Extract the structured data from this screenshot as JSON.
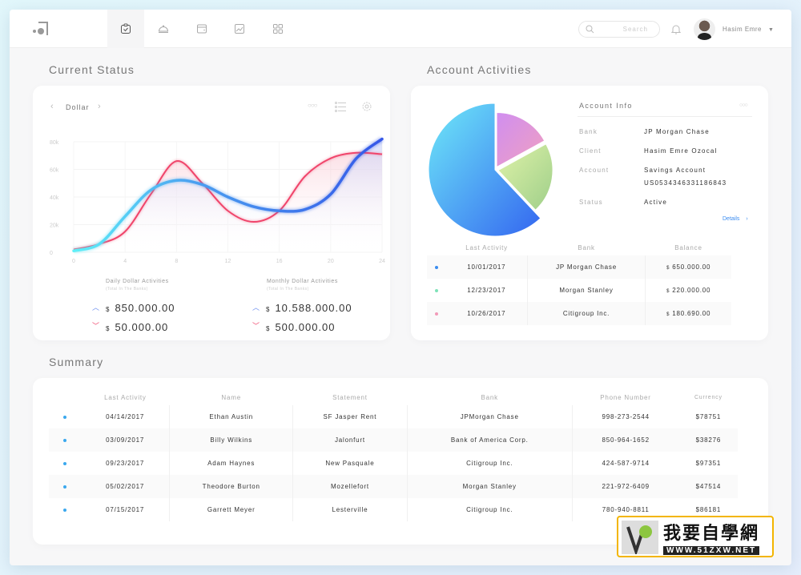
{
  "header": {
    "search_placeholder": "Search",
    "user_name": "Hasim Emre",
    "nav_icons": [
      "clipboard-check-icon",
      "cloche-icon",
      "wallet-icon",
      "chart-image-icon",
      "grid-icon"
    ],
    "active_nav": 0
  },
  "current_status": {
    "title": "Current Status",
    "currency": "Dollar",
    "daily": {
      "label": "Daily Dollar Activities",
      "sub": "(Total In The Banks)",
      "up": "850.000.00",
      "down": "50.000.00"
    },
    "monthly": {
      "label": "Monthly Dollar Activities",
      "sub": "(Total In The Banks)",
      "up": "10.588.000.00",
      "down": "500.000.00"
    },
    "currency_symbol": "$"
  },
  "chart_data": {
    "type": "line",
    "x": [
      0,
      2,
      4,
      6,
      8,
      10,
      12,
      14,
      16,
      18,
      20,
      22,
      24
    ],
    "xticks": [
      "0",
      "4",
      "8",
      "12",
      "16",
      "20",
      "24"
    ],
    "yticks": [
      "0",
      "20k",
      "40k",
      "60k",
      "80k"
    ],
    "xlim": [
      0,
      24
    ],
    "ylim": [
      0,
      80000
    ],
    "grid": true,
    "series": [
      {
        "color": "#3b82f6",
        "values": [
          1000,
          6000,
          26000,
          45000,
          52000,
          49000,
          40000,
          33000,
          30000,
          31000,
          42000,
          68000,
          82000
        ]
      },
      {
        "color": "#f0456b",
        "values": [
          2000,
          6000,
          15000,
          42000,
          66000,
          50000,
          30000,
          22000,
          30000,
          55000,
          68000,
          72000,
          71000
        ]
      }
    ]
  },
  "account": {
    "title": "Account Activities",
    "info_title": "Account Info",
    "fields": [
      {
        "k": "Bank",
        "v": "JP Morgan Chase"
      },
      {
        "k": "Client",
        "v": "Hasim Emre Ozocal"
      },
      {
        "k": "Account",
        "v": "Savings Account",
        "v2": "US0534346331186843"
      },
      {
        "k": "Status",
        "v": "Active"
      }
    ],
    "details": "Details",
    "pie": [
      {
        "share": 62,
        "colors": [
          "#6ee9f8",
          "#3466f0"
        ]
      },
      {
        "share": 17,
        "colors": [
          "#d08ef0",
          "#f0a0c0"
        ]
      },
      {
        "share": 21,
        "colors": [
          "#dff2a8",
          "#9fcf8a"
        ]
      }
    ],
    "headers": [
      "Last Activity",
      "Bank",
      "Balance"
    ],
    "rows": [
      {
        "dot": "#3b8cf0",
        "date": "10/01/2017",
        "bank": "JP Morgan Chase",
        "bal": "650.000.00"
      },
      {
        "dot": "#7ee2b8",
        "date": "12/23/2017",
        "bank": "Morgan Stanley",
        "bal": "220.000.00"
      },
      {
        "dot": "#f29ab8",
        "date": "10/26/2017",
        "bank": "Citigroup Inc.",
        "bal": "180.690.00"
      }
    ]
  },
  "summary": {
    "title": "Summary",
    "headers": [
      "Last Activity",
      "Name",
      "Statement",
      "Bank",
      "Phone Number",
      "Currency"
    ],
    "rows": [
      [
        "04/14/2017",
        "Ethan Austin",
        "SF Jasper Rent",
        "JPMorgan Chase",
        "998-273-2544",
        "$78751"
      ],
      [
        "03/09/2017",
        "Billy Wilkins",
        "Jalonfurt",
        "Bank of America Corp.",
        "850-964-1652",
        "$38276"
      ],
      [
        "09/23/2017",
        "Adam Haynes",
        "New Pasquale",
        "Citigroup Inc.",
        "424-587-9714",
        "$97351"
      ],
      [
        "05/02/2017",
        "Theodore Burton",
        "Mozellefort",
        "Morgan Stanley",
        "221-972-6409",
        "$47514"
      ],
      [
        "07/15/2017",
        "Garrett Meyer",
        "Lesterville",
        "Citigroup Inc.",
        "780-940-8811",
        "$86181"
      ]
    ]
  },
  "watermark": {
    "text": "我要自學網",
    "url": "WWW.51ZXW.NET"
  }
}
